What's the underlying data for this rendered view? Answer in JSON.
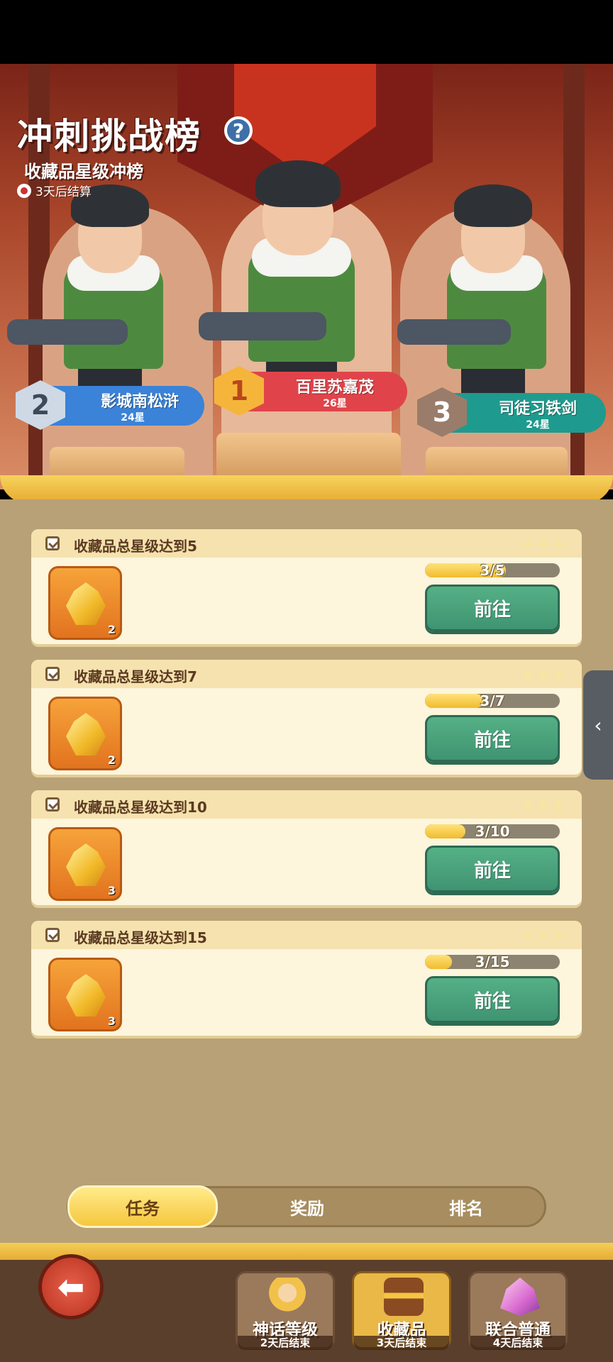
{
  "header": {
    "title": "冲刺挑战榜",
    "help_glyph": "?",
    "subtitle": "收藏品星级冲榜",
    "countdown": "3天后结算"
  },
  "podium": [
    {
      "rank": "1",
      "name": "百里苏嘉茂",
      "stars": "26星",
      "color": "#e0444a"
    },
    {
      "rank": "2",
      "name": "影城南松浒",
      "stars": "24星",
      "color": "#3a83d8"
    },
    {
      "rank": "3",
      "name": "司徒习铁剑",
      "stars": "24星",
      "color": "#1e9b8e"
    }
  ],
  "tasks": [
    {
      "title": "收藏品总星级达到5",
      "reward_qty": "2",
      "progress_text": "3/5",
      "progress": 0.6,
      "button": "前往"
    },
    {
      "title": "收藏品总星级达到7",
      "reward_qty": "2",
      "progress_text": "3/7",
      "progress": 0.43,
      "button": "前往"
    },
    {
      "title": "收藏品总星级达到10",
      "reward_qty": "3",
      "progress_text": "3/10",
      "progress": 0.3,
      "button": "前往"
    },
    {
      "title": "收藏品总星级达到15",
      "reward_qty": "3",
      "progress_text": "3/15",
      "progress": 0.2,
      "button": "前往"
    }
  ],
  "side_tab_glyph": "‹",
  "tabs": [
    {
      "label": "任务",
      "active": true
    },
    {
      "label": "奖励",
      "active": false
    },
    {
      "label": "排名",
      "active": false
    }
  ],
  "bottom_nav": {
    "back_glyph": "⬅",
    "items": [
      {
        "label": "神话等级",
        "sub": "2天后结束",
        "icon": "hero-icon"
      },
      {
        "label": "收藏品",
        "sub": "3天后结束",
        "icon": "treasure-chest-icon"
      },
      {
        "label": "联合普通",
        "sub": "4天后结束",
        "icon": "crystal-icon"
      }
    ]
  }
}
